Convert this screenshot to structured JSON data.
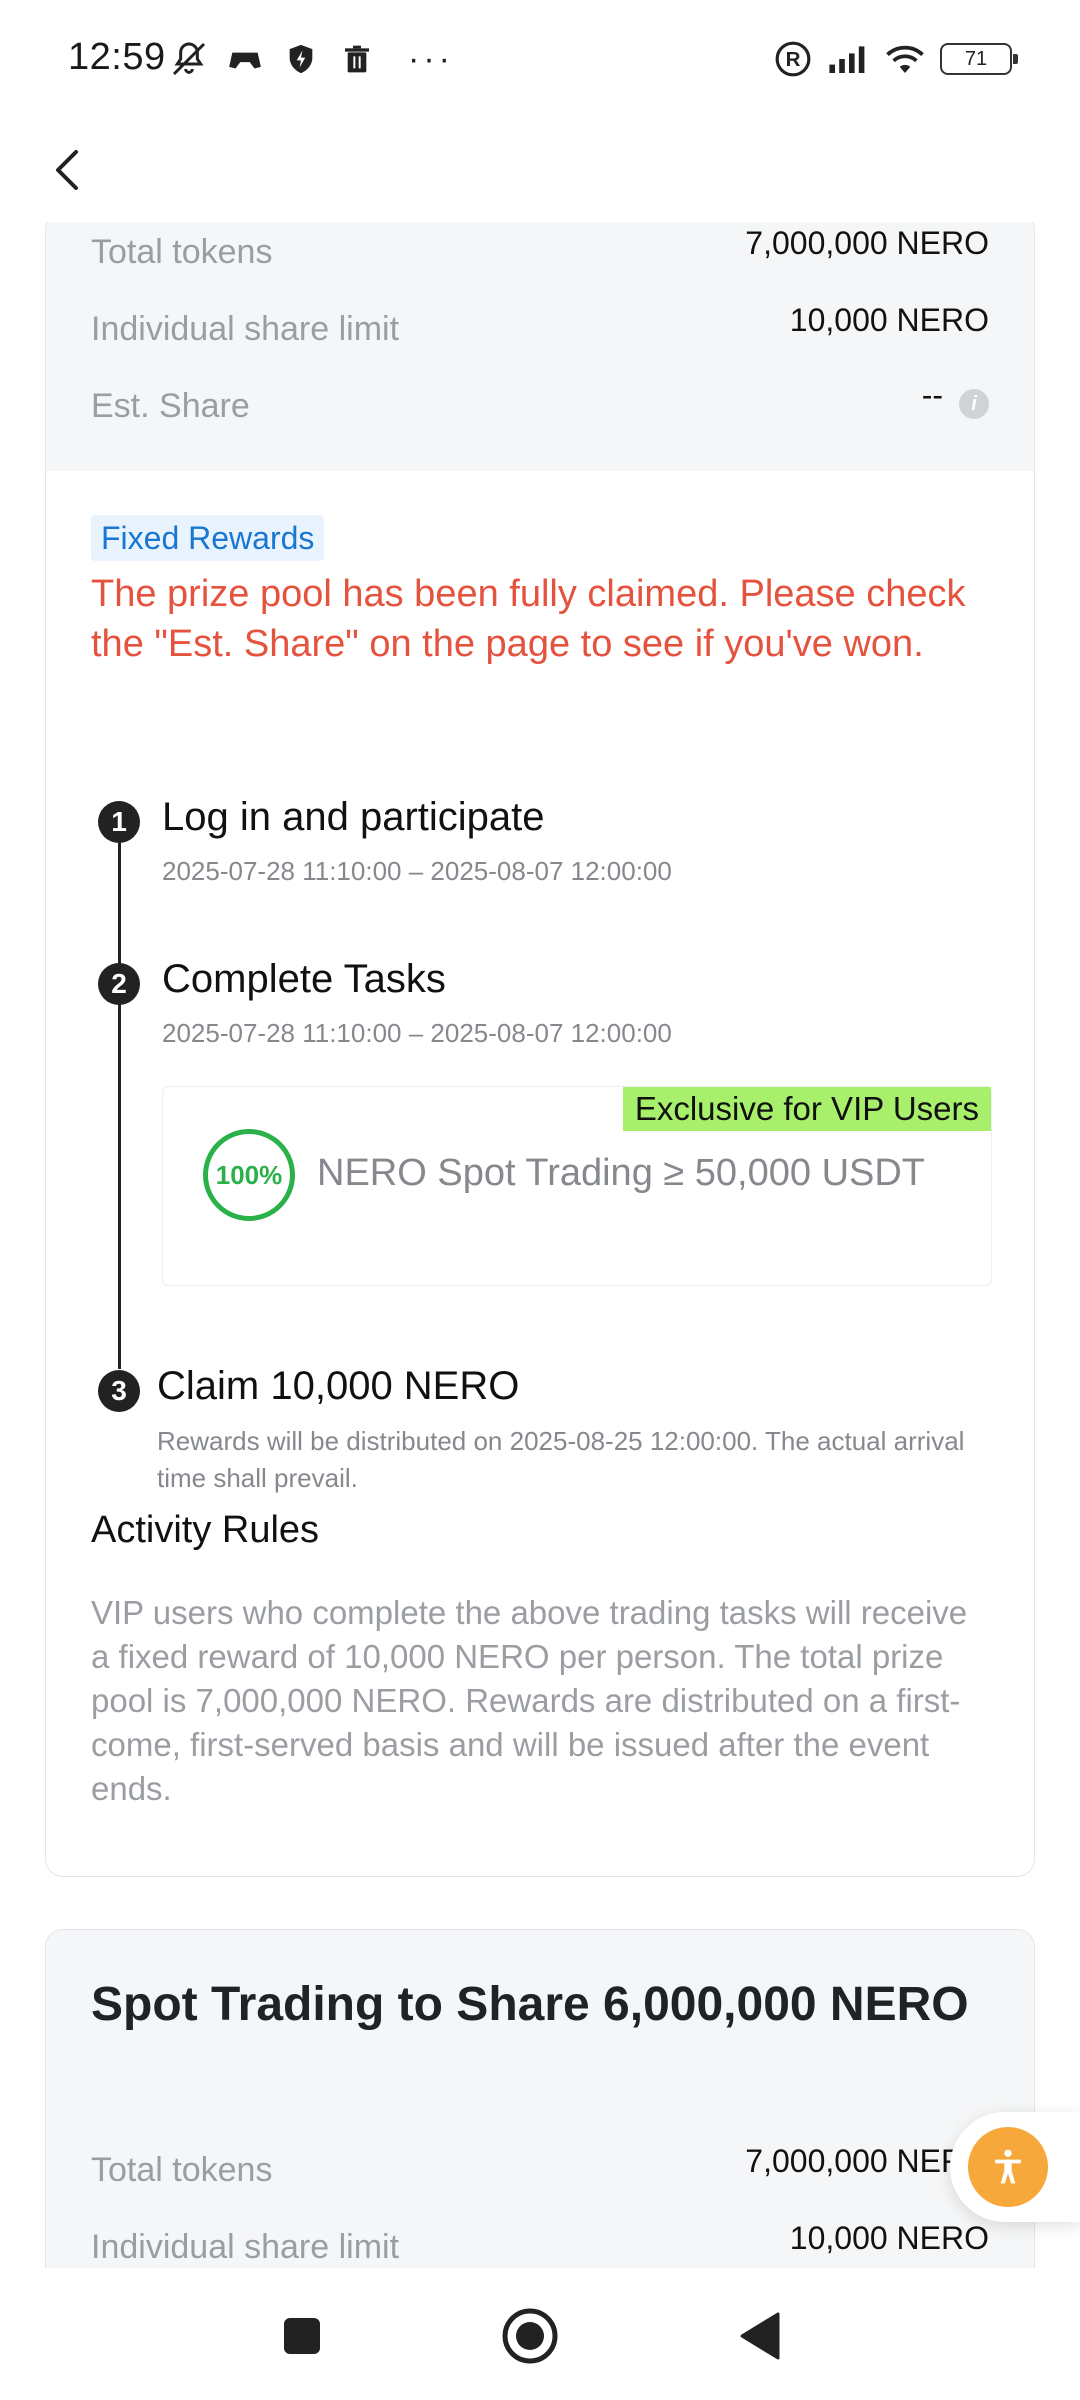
{
  "status_bar": {
    "time": "12:59",
    "battery": "71",
    "icons_left": [
      "mute-icon",
      "game-controller-icon",
      "shield-bolt-icon",
      "trash-icon"
    ],
    "icons_right": [
      "registered-icon",
      "signal-icon",
      "wifi-icon",
      "battery-icon"
    ]
  },
  "card1": {
    "rows": [
      {
        "label": "Total tokens",
        "value": "7,000,000 NERO"
      },
      {
        "label": "Individual share limit",
        "value": "10,000 NERO"
      },
      {
        "label": "Est. Share",
        "value": "--"
      }
    ],
    "tag": "Fixed Rewards",
    "notice": "The prize pool has been fully claimed. Please check the \"Est. Share\" on the page to see if you've won.",
    "steps": [
      {
        "num": "1",
        "title": "Log in and participate",
        "time": "2025-07-28 11:10:00 – 2025-08-07 12:00:00"
      },
      {
        "num": "2",
        "title": "Complete Tasks",
        "time": "2025-07-28 11:10:00 – 2025-08-07 12:00:00"
      },
      {
        "num": "3",
        "title": "Claim 10,000 NERO",
        "time": "Rewards will be distributed on 2025-08-25 12:00:00. The actual arrival time shall prevail."
      }
    ],
    "task": {
      "tag": "Exclusive for VIP Users",
      "progress": "100%",
      "text": "NERO Spot Trading ≥ 50,000 USDT"
    },
    "rules_title": "Activity Rules",
    "rules_text": "VIP users who complete the above trading tasks will receive a fixed reward of 10,000 NERO per person. The total prize pool is 7,000,000 NERO. Rewards are distributed on a first-come, first-served basis and will be issued after the event ends."
  },
  "card2": {
    "title": "Spot Trading to Share 6,000,000 NERO",
    "rows": [
      {
        "label": "Total tokens",
        "value": "7,000,000 NERO"
      },
      {
        "label": "Individual share limit",
        "value": "10,000 NERO"
      }
    ]
  },
  "colors": {
    "notice_red": "#e5523d",
    "tag_blue": "#1877d2",
    "vip_green": "#a8ef6b",
    "progress_green": "#2bb14a",
    "fab_orange": "#f6a93a"
  }
}
